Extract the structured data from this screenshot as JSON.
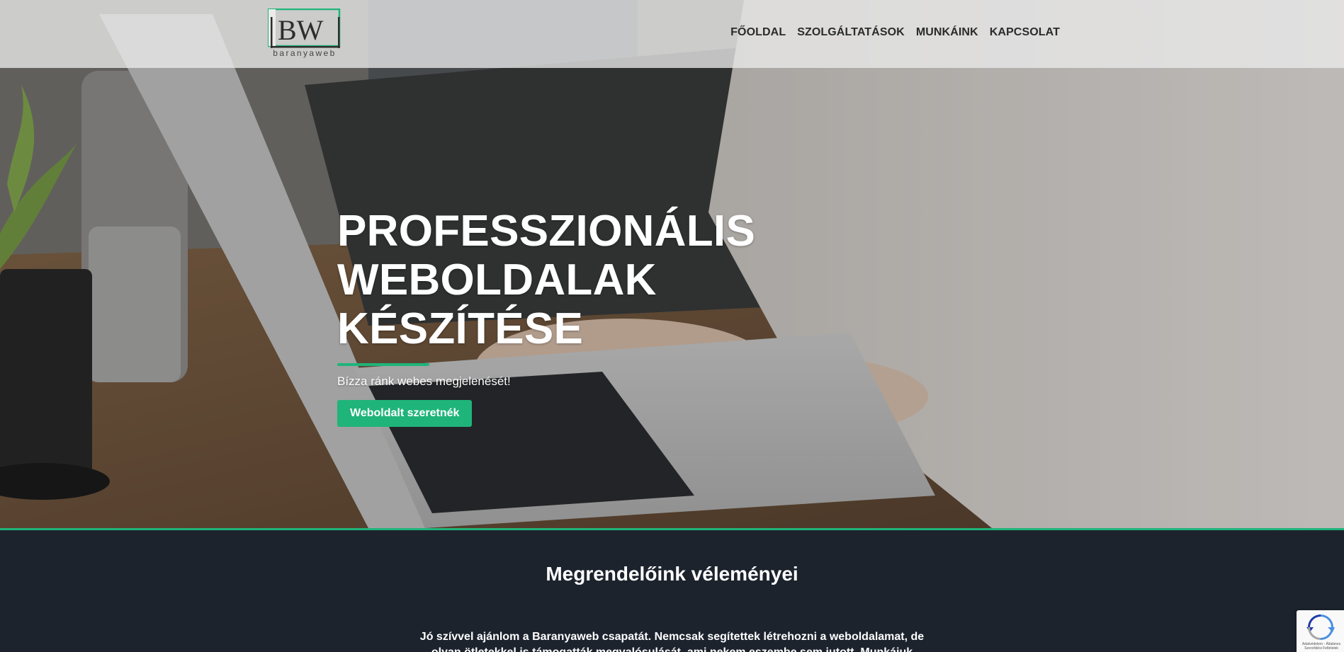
{
  "header": {
    "logo_letters": "BW",
    "logo_wordmark": "baranyaweb",
    "nav": [
      {
        "label": "FŐOLDAL"
      },
      {
        "label": "SZOLGÁLTATÁSOK"
      },
      {
        "label": "MUNKÁINK"
      },
      {
        "label": "KAPCSOLAT"
      }
    ]
  },
  "hero": {
    "title_line1": "PROFESSZIONÁLIS WEBOLDALAK",
    "title_line2": "KÉSZÍTÉSE",
    "subtitle": "Bízza ránk webes megjelenését!",
    "cta_label": "Weboldalt szeretnék"
  },
  "testimonials": {
    "title": "Megrendelőink véleményei",
    "quote": "Jó szívvel ajánlom a Baranyaweb csapatát. Nemcsak segítettek létrehozni a weboldalamat, de olyan ötletekkel is támogatták megvalósulását, ami nekem eszembe sem jutott. Munkájuk eredménye"
  },
  "recaptcha": {
    "label": "Adatvédelem - Általános Szerződési Feltételek"
  },
  "colors": {
    "accent": "#1fb47a",
    "dark_bg": "#1c232d",
    "header_bg": "#ebebeb"
  }
}
